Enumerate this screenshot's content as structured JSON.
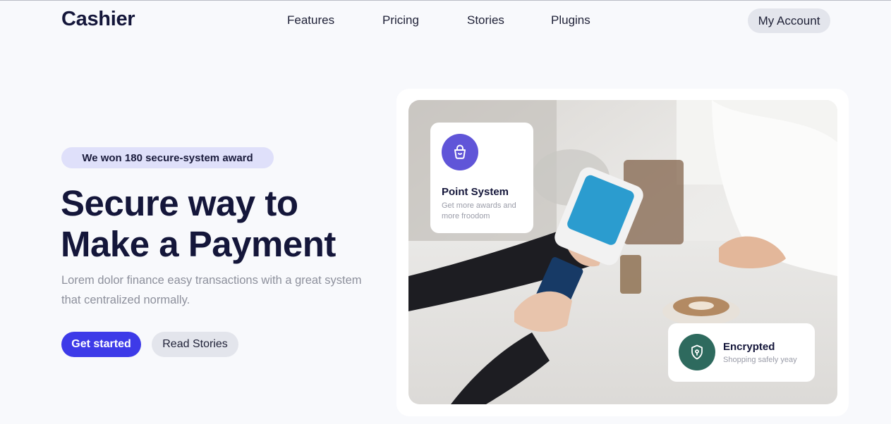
{
  "header": {
    "logo": "Cashier",
    "nav": [
      {
        "label": "Features"
      },
      {
        "label": "Pricing"
      },
      {
        "label": "Stories"
      },
      {
        "label": "Plugins"
      }
    ],
    "account_label": "My Account"
  },
  "hero": {
    "badge": "We won 180 secure-system award",
    "title_line1": "Secure way to",
    "title_line2": "Make a Payment",
    "subtitle": "Lorem dolor finance easy transactions with a great system that centralized normally.",
    "primary_cta": "Get started",
    "secondary_cta": "Read Stories"
  },
  "cards": {
    "point": {
      "title": "Point System",
      "subtitle": "Get more awards and more froodom",
      "icon": "shopping-basket-icon"
    },
    "encrypted": {
      "title": "Encrypted",
      "subtitle": "Shopping safely yeay",
      "icon": "shield-lock-icon"
    }
  },
  "colors": {
    "accent": "#3d3ae8",
    "text_dark": "#14163a",
    "badge_bg": "#dfe0fa",
    "point_icon_bg": "#6055d8",
    "encrypted_icon_bg": "#2e6a5e"
  }
}
